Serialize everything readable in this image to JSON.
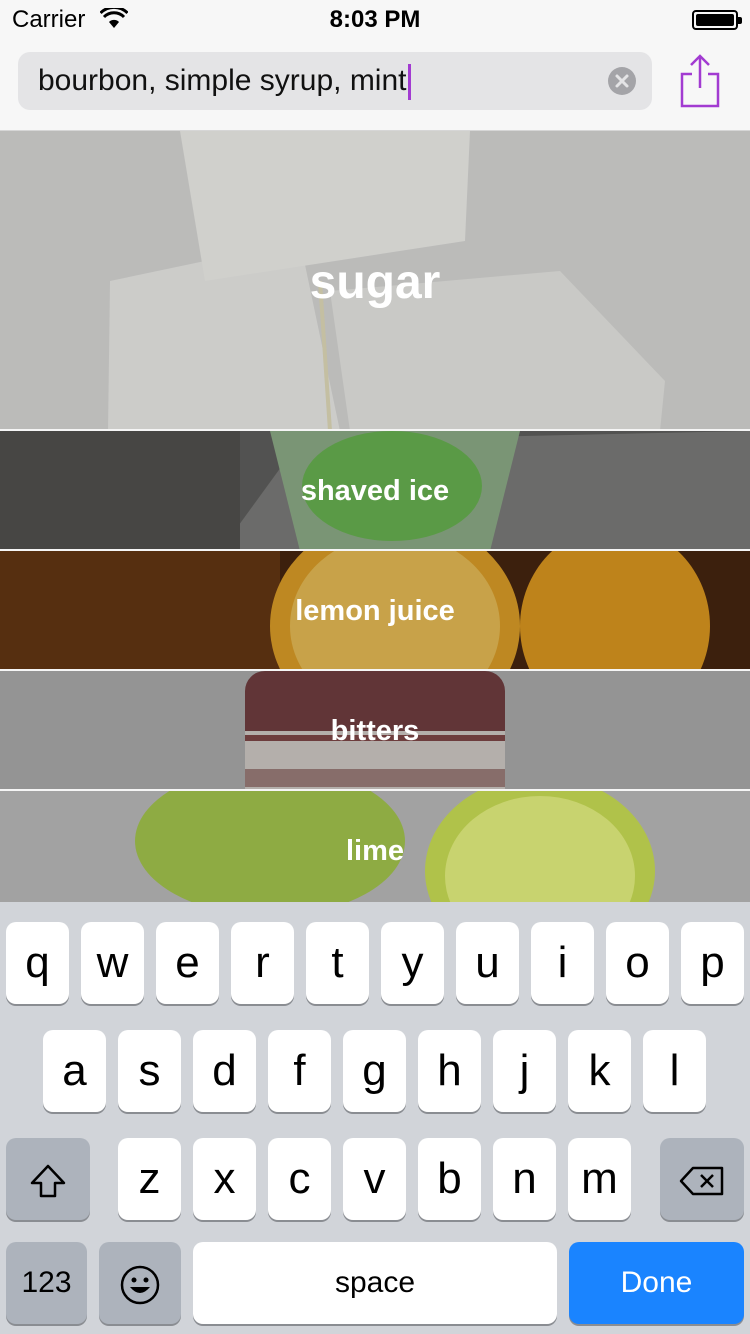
{
  "status_bar": {
    "carrier": "Carrier",
    "time": "8:03 PM"
  },
  "search": {
    "value": "bourbon, simple syrup, mint"
  },
  "ingredients": [
    {
      "label": "sugar"
    },
    {
      "label": "shaved ice"
    },
    {
      "label": "lemon juice"
    },
    {
      "label": "bitters"
    },
    {
      "label": "lime"
    }
  ],
  "keyboard": {
    "row1": [
      "q",
      "w",
      "e",
      "r",
      "t",
      "y",
      "u",
      "i",
      "o",
      "p"
    ],
    "row2": [
      "a",
      "s",
      "d",
      "f",
      "g",
      "h",
      "j",
      "k",
      "l"
    ],
    "row3": [
      "z",
      "x",
      "c",
      "v",
      "b",
      "n",
      "m"
    ],
    "numbers_label": "123",
    "space_label": "space",
    "done_label": "Done"
  },
  "colors": {
    "accent": "#a23bd1",
    "done_button": "#1a84ff"
  }
}
